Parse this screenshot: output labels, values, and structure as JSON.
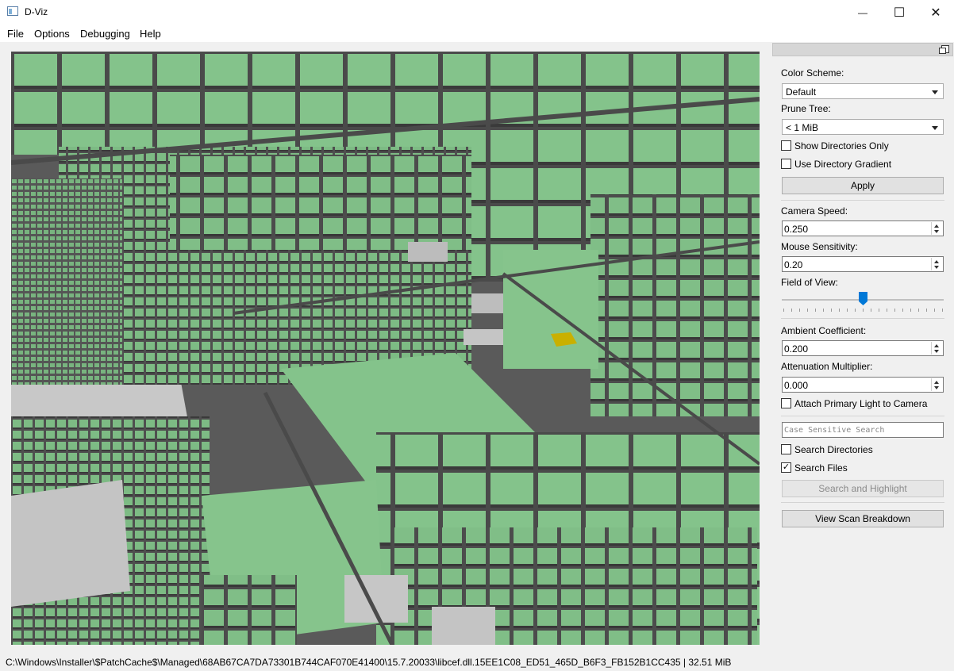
{
  "window": {
    "title": "D-Viz",
    "minimize_glyph": "—",
    "maximize_glyph": "☐",
    "close_glyph": "✕"
  },
  "menu": [
    "File",
    "Options",
    "Debugging",
    "Help"
  ],
  "panel": {
    "color_scheme": {
      "label": "Color Scheme:",
      "value": "Default"
    },
    "prune_tree": {
      "label": "Prune Tree:",
      "value": "< 1 MiB"
    },
    "show_directories_only": {
      "label": "Show Directories Only",
      "checked": false
    },
    "use_directory_gradient": {
      "label": "Use Directory Gradient",
      "checked": false
    },
    "apply_label": "Apply",
    "camera_speed": {
      "label": "Camera Speed:",
      "value": "0.250"
    },
    "mouse_sensitivity": {
      "label": "Mouse Sensitivity:",
      "value": "0.20"
    },
    "field_of_view": {
      "label": "Field of View:",
      "position_fraction": 0.5
    },
    "ambient_coefficient": {
      "label": "Ambient Coefficient:",
      "value": "0.200"
    },
    "attenuation_multiplier": {
      "label": "Attenuation Multiplier:",
      "value": "0.000"
    },
    "attach_primary_light": {
      "label": "Attach Primary Light to Camera",
      "checked": false
    },
    "search_placeholder": "Case Sensitive Search",
    "search_directories": {
      "label": "Search Directories",
      "checked": false
    },
    "search_files": {
      "label": "Search Files",
      "checked": true
    },
    "search_button_label": "Search and Highlight",
    "view_scan_breakdown_label": "View Scan Breakdown"
  },
  "status": {
    "path": "C:\\Windows\\Installer\\$PatchCache$\\Managed\\68AB67CA7DA73301B744CAF070E41400\\15.7.20033\\libcef.dll.15EE1C08_ED51_465D_B6F3_FB152B1CC435",
    "size": "32.51 MiB"
  },
  "colors": {
    "block_green": "#7dbb84",
    "block_shadow": "#5a5a5a",
    "highlight_yellow": "#c9b000",
    "slider_handle": "#0078d7"
  }
}
